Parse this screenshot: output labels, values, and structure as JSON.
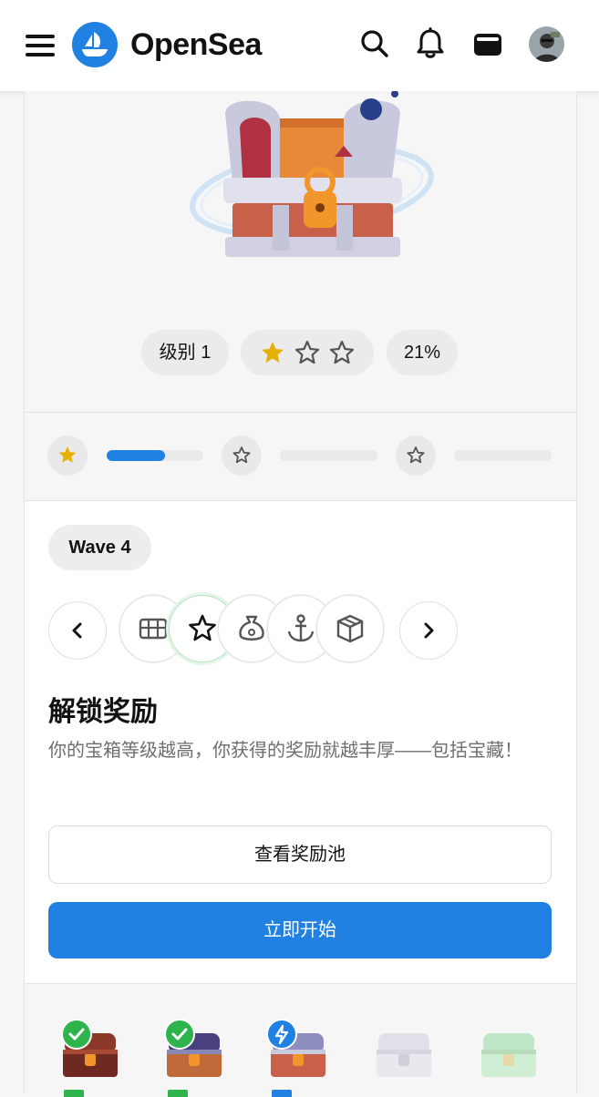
{
  "header": {
    "brand": "OpenSea",
    "icons": [
      "hamburger-menu-icon",
      "opensea-logo",
      "search-icon",
      "bell-icon",
      "wallet-icon",
      "avatar"
    ]
  },
  "hero": {
    "level_label": "级别 1",
    "stars_filled": 1,
    "stars_total": 3,
    "percent": "21%"
  },
  "progress": {
    "segments": [
      {
        "star": "filled",
        "fill": 0.6
      },
      {
        "star": "empty",
        "fill": 0
      },
      {
        "star": "empty",
        "fill": 0
      }
    ]
  },
  "wave": {
    "label": "Wave 4"
  },
  "rewards": {
    "icons": [
      "grid-icon",
      "star-icon",
      "bag-icon",
      "anchor-icon",
      "box-icon"
    ],
    "active_index": 1
  },
  "unlock": {
    "title": "解锁奖励",
    "description": "你的宝箱等级越高，你获得的奖励就越丰厚——包括宝藏！",
    "view_pool_button": "查看奖励池",
    "start_button": "立即开始"
  },
  "chests": [
    {
      "status": "completed"
    },
    {
      "status": "completed"
    },
    {
      "status": "active"
    },
    {
      "status": "locked"
    },
    {
      "status": "locked"
    }
  ],
  "colors": {
    "accent": "#2081e2",
    "star_gold": "#e5b100",
    "check_green": "#2eb34d"
  }
}
